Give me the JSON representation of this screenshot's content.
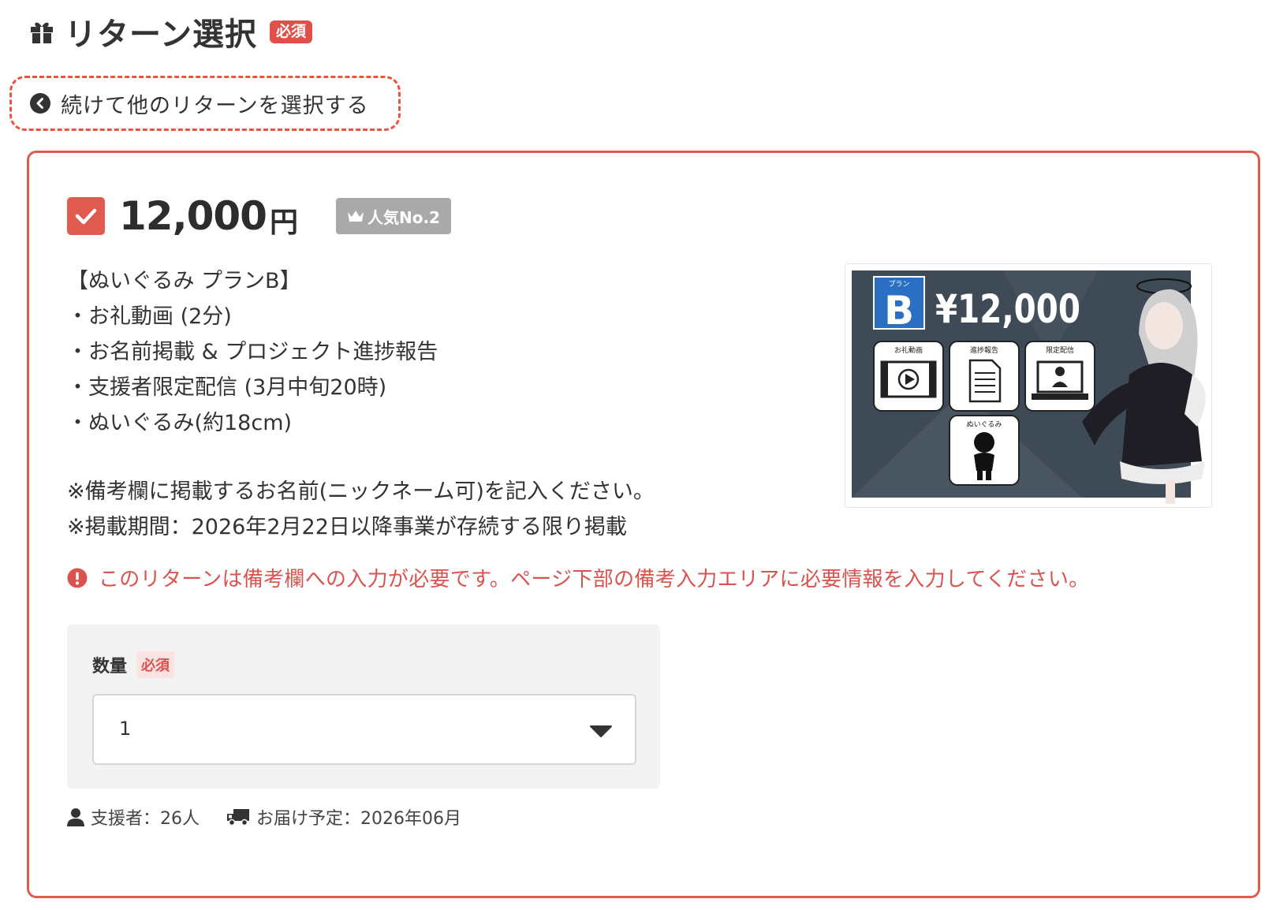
{
  "header": {
    "title": "リターン選択",
    "required_badge": "必須"
  },
  "back_link": {
    "label": "続けて他のリターンを選択する"
  },
  "reward": {
    "checked": true,
    "price_amount": "12,000",
    "price_unit": "円",
    "rank_badge": "人気No.2",
    "description_lines": [
      "【ぬいぐるみ プランB】",
      "・お礼動画 (2分)",
      "・お名前掲載 & プロジェクト進捗報告",
      "・支援者限定配信 (3月中旬20時)",
      "・ぬいぐるみ(約18cm)"
    ],
    "note_lines": [
      "※備考欄に掲載するお名前(ニックネーム可)を記入ください。",
      "※掲載期間：2026年2月22日以降事業が存続する限り掲載"
    ],
    "image": {
      "plan_label": "プラン",
      "plan_letter": "B",
      "price_text": "¥12,000",
      "tiles": [
        "お礼動画",
        "進捗報告",
        "限定配信",
        "ぬいぐるみ"
      ]
    },
    "notice": "このリターンは備考欄への入力が必要です。ページ下部の備考入力エリアに必要情報を入力してください。",
    "quantity": {
      "label": "数量",
      "required_badge": "必須",
      "value": "1"
    },
    "backers": "支援者：26人",
    "delivery": "お届け予定：2026年06月"
  },
  "colors": {
    "accent": "#e05a4f",
    "dashed_highlight": "#e8553f",
    "badge_gray": "#a9a9a9",
    "notice_red": "#d9534f"
  }
}
